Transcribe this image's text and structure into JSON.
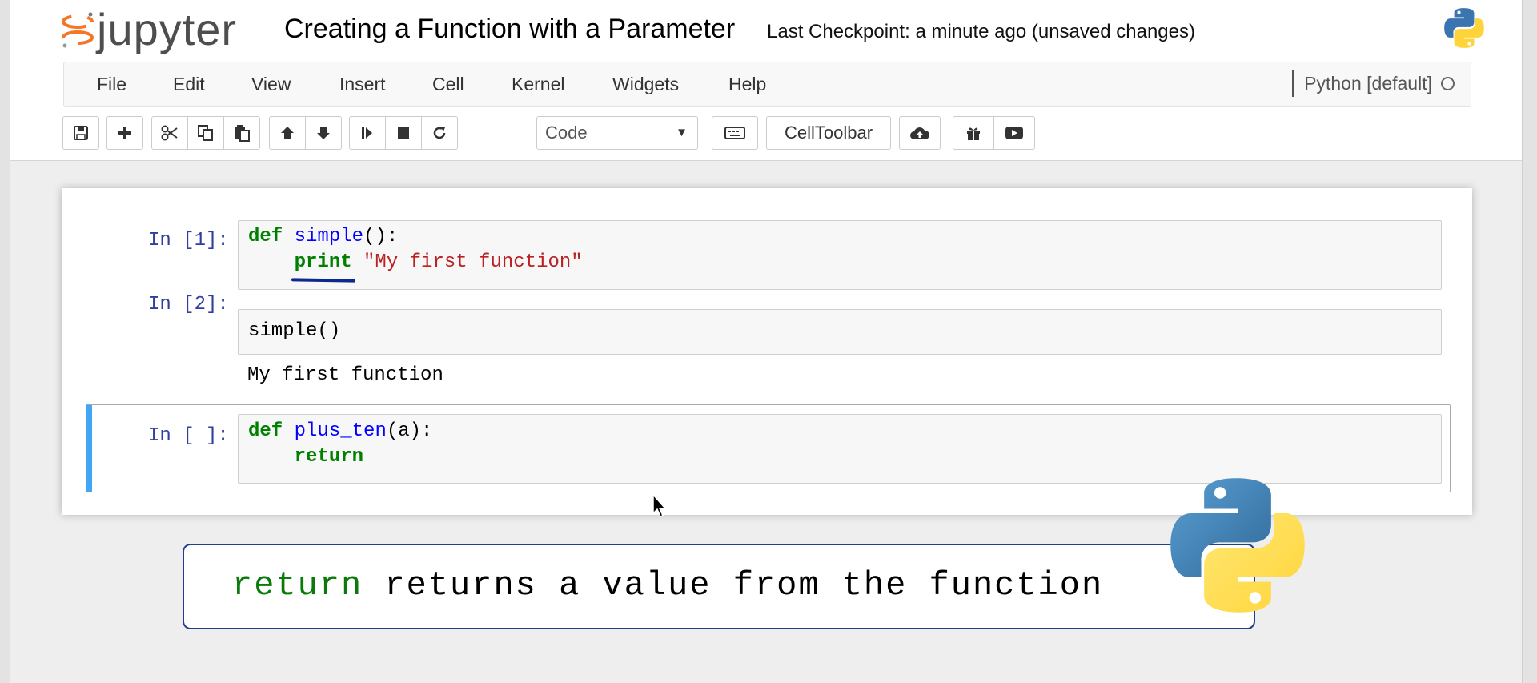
{
  "header": {
    "logo_text": "jupyter",
    "notebook_title": "Creating a Function with a Parameter",
    "checkpoint_text": "Last Checkpoint: a minute ago (unsaved changes)"
  },
  "menu": {
    "items": [
      "File",
      "Edit",
      "View",
      "Insert",
      "Cell",
      "Kernel",
      "Widgets",
      "Help"
    ],
    "kernel_name": "Python [default]"
  },
  "toolbar": {
    "cell_type": "Code",
    "celltoolbar_label": "CellToolbar",
    "icons": [
      "save-icon",
      "plus-icon",
      "scissors-icon",
      "copy-icon",
      "paste-icon",
      "arrow-up-icon",
      "arrow-down-icon",
      "step-forward-icon",
      "stop-icon",
      "refresh-icon",
      "keyboard-icon",
      "cloud-upload-icon",
      "gift-icon",
      "play-circle-icon"
    ]
  },
  "cells": [
    {
      "prompt": "In [1]:",
      "line1": {
        "kw": "def",
        "name": "simple",
        "rest": "():"
      },
      "line2": {
        "indent": "    ",
        "kw": "print",
        "space": " ",
        "str": "\"My first function\""
      }
    },
    {
      "prompt": "In [2]:",
      "code": "simple()",
      "output": "My first function"
    },
    {
      "prompt": "In [ ]:",
      "line1": {
        "kw": "def",
        "name": "plus_ten",
        "rest": "(a):"
      },
      "line2": {
        "indent": "    ",
        "kw": "return"
      }
    }
  ],
  "caption": {
    "keyword": "return",
    "text": " returns a value from the function"
  },
  "colors": {
    "keyword": "#008000",
    "function_name": "#0000ff",
    "string": "#ba2121",
    "prompt": "#303f9f",
    "selected_cell_bar": "#42a5f5"
  }
}
